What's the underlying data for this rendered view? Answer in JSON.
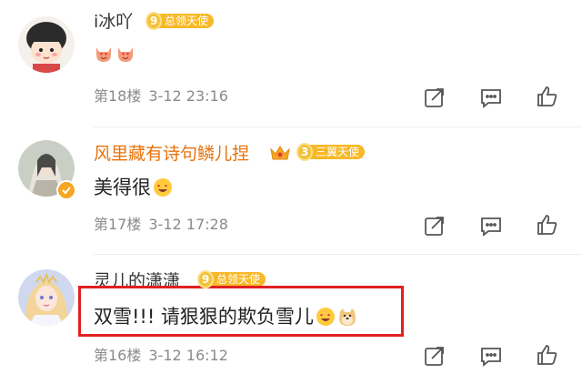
{
  "comments": [
    {
      "username": "i冰吖",
      "username_color": "#333333",
      "badge_level": "9",
      "badge_title": "总领天使",
      "text": "",
      "emojis": [
        "heart-eyes-cat-emoji",
        "heart-eyes-cat-emoji"
      ],
      "floor": "第18楼",
      "time": "3-12 23:16"
    },
    {
      "username": "风里藏有诗句鳞儿捏",
      "username_color": "#e8730c",
      "badge_level": "3",
      "badge_title": "三翼天使",
      "text": "美得很",
      "emojis": [
        "heart-eyes-emoji"
      ],
      "floor": "第17楼",
      "time": "3-12 17:28"
    },
    {
      "username": "灵儿的潇潇",
      "username_color": "#333333",
      "badge_level": "9",
      "badge_title": "总领天使",
      "text": "双雪!!! 请狠狠的欺负雪儿",
      "emojis": [
        "heart-eyes-emoji",
        "doge-emoji"
      ],
      "floor": "第16楼",
      "time": "3-12 16:12"
    }
  ],
  "icons": {
    "share": "share-icon",
    "comment": "comment-icon",
    "like": "like-icon"
  },
  "colors": {
    "meta_text": "#8a8a8a",
    "badge_gold": "#f7b928",
    "highlight": "#e02020"
  }
}
